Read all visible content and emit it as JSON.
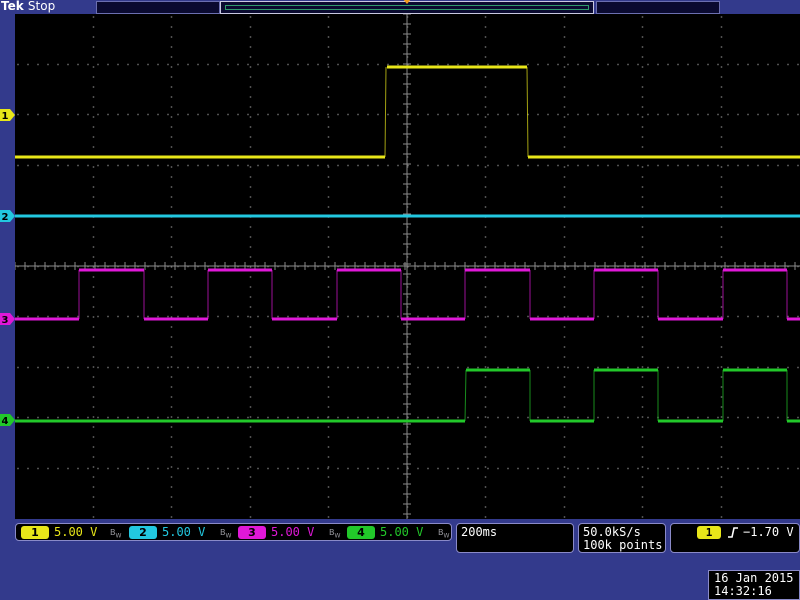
{
  "header": {
    "brand": "Tek",
    "state": "Stop"
  },
  "colors": {
    "ch1": "#e8e619",
    "ch2": "#22c8e0",
    "ch3": "#e018d8",
    "ch4": "#22c82a",
    "trigger": "#f29b1c",
    "frame": "#333a8c"
  },
  "channels": [
    {
      "id": "1",
      "scale": "5.00 V",
      "bandwidth_icon": "bw-limit-icon"
    },
    {
      "id": "2",
      "scale": "5.00 V",
      "bandwidth_icon": "bw-limit-icon"
    },
    {
      "id": "3",
      "scale": "5.00 V",
      "bandwidth_icon": "bw-limit-icon"
    },
    {
      "id": "4",
      "scale": "5.00 V",
      "bandwidth_icon": "bw-limit-icon"
    }
  ],
  "timebase": {
    "horizontal_scale": "200ms",
    "sample_rate": "50.0kS/s",
    "record_length": "100k points"
  },
  "trigger": {
    "source": "1",
    "slope_icon": "rising-edge-icon",
    "level": "−1.70 V"
  },
  "datetime": {
    "date": "16 Jan  2015",
    "time": "14:32:16"
  }
}
